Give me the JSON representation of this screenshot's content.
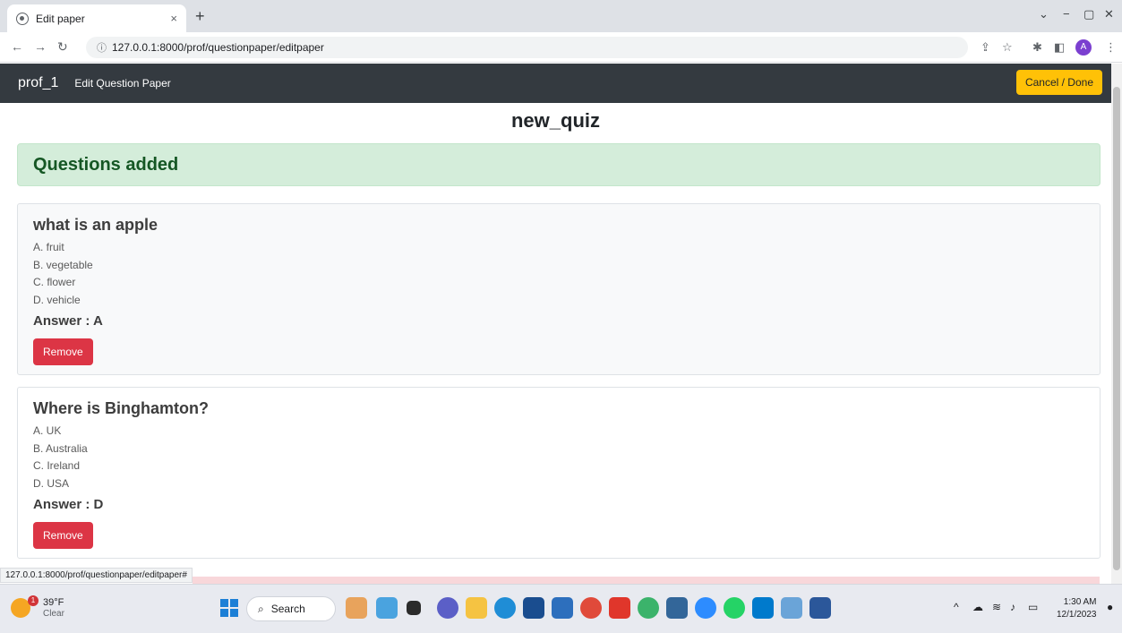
{
  "browser": {
    "tab_title": "Edit paper",
    "tab_close": "×",
    "new_tab": "+",
    "url": "127.0.0.1:8000/prof/questionpaper/editpaper",
    "avatar_letter": "A",
    "status_url": "127.0.0.1:8000/prof/questionpaper/editpaper#"
  },
  "navbar": {
    "brand": "prof_1",
    "link": "Edit Question Paper",
    "cancel_label": "Cancel / Done"
  },
  "page": {
    "quiz_title": "new_quiz",
    "alert": "Questions added"
  },
  "questions": [
    {
      "text": "what is an apple",
      "options": [
        "A. fruit",
        "B. vegetable",
        "C. flower",
        "D. vehicle"
      ],
      "answer": "Answer : A",
      "remove_label": "Remove"
    },
    {
      "text": "Where is Binghamton?",
      "options": [
        "A. UK",
        "B. Australia",
        "C. Ireland",
        "D. USA"
      ],
      "answer": "Answer : D",
      "remove_label": "Remove"
    }
  ],
  "taskbar": {
    "weather_temp": "39°F",
    "weather_desc": "Clear",
    "weather_badge": "1",
    "search_label": "Search",
    "time": "1:30 AM",
    "date": "12/1/2023"
  },
  "colors": {
    "navbar_bg": "#343a40",
    "warning": "#ffc107",
    "danger": "#dc3545",
    "success_bg": "#d4edda",
    "success_text": "#155724"
  }
}
